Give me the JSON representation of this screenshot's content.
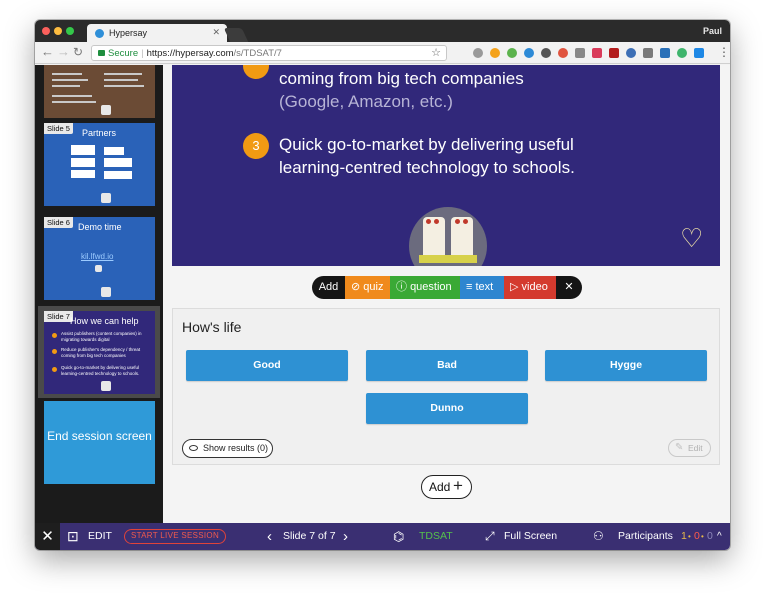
{
  "browser": {
    "tab_title": "Hypersay",
    "profile_name": "Paul",
    "secure_label": "Secure",
    "url_host": "https://hypersay.com",
    "url_path": "/s/TDSAT/7"
  },
  "sidebar": {
    "thumbnails": [
      {
        "label": "Slide 5",
        "title": "Partners"
      },
      {
        "label": "Slide 6",
        "title": "Demo time",
        "link": "kil.lfwd.io"
      },
      {
        "label": "Slide 7",
        "title": "How we can help",
        "bullets": [
          "Assist publishers (content companies) in migrating towards digital",
          "Reduce publisher's dependency / threat coming from big tech companies",
          "Quick go-to-market by delivering useful learning-centred technology to schools."
        ]
      },
      {
        "label": "",
        "title": "End session screen"
      }
    ]
  },
  "slide": {
    "line1": "coming from big tech companies",
    "line2": "(Google, Amazon, etc.)",
    "item3_number": "3",
    "item3_line1": "Quick go-to-market by delivering useful",
    "item3_line2": "learning-centred technology to schools."
  },
  "add_toolbar": {
    "add": "Add",
    "quiz": "quiz",
    "question": "question",
    "text": "text",
    "video": "video",
    "close": "✕"
  },
  "question": {
    "title": "How's life",
    "options": [
      "Good",
      "Bad",
      "Hygge",
      "Dunno"
    ],
    "show_results": "Show results (0)",
    "edit": "Edit"
  },
  "add_more": "Add",
  "bottom_bar": {
    "close": "✕",
    "edit": "EDIT",
    "start_live": "START LIVE SESSION",
    "slide_counter": "Slide 7 of 7",
    "session_code": "TDSAT",
    "fullscreen": "Full Screen",
    "participants": "Participants",
    "count_1": "1",
    "count_2": "0",
    "count_3": "0"
  },
  "colors": {
    "slide_bg": "#31287a",
    "accent_orange": "#f19a13",
    "option_blue": "#2e91d3",
    "bottom_bar": "#3a2f72"
  }
}
